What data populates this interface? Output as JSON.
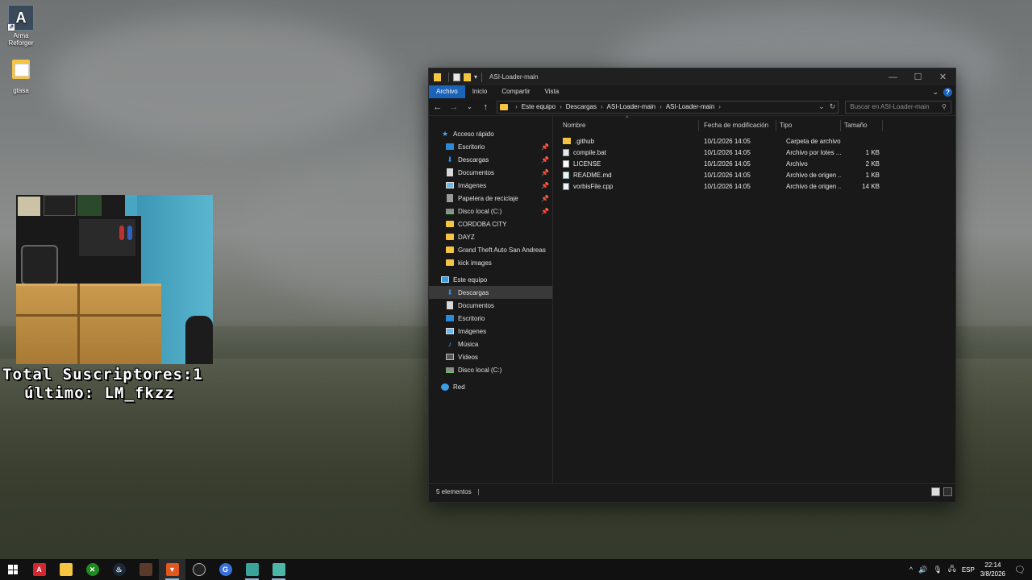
{
  "desktop": {
    "icons": [
      {
        "label_line1": "Arma",
        "label_line2": "Reforger"
      },
      {
        "label_line1": "gtasa",
        "label_line2": ""
      }
    ]
  },
  "overlay": {
    "subs_line": "Total Suscriptores:1",
    "last_line": "último: LM_fkzz"
  },
  "explorer": {
    "title": "ASI-Loader-main",
    "ribbon_tabs": [
      "Archivo",
      "Inicio",
      "Compartir",
      "Vista"
    ],
    "breadcrumb": [
      "Este equipo",
      "Descargas",
      "ASI-Loader-main",
      "ASI-Loader-main"
    ],
    "search_placeholder": "Buscar en ASI-Loader-main",
    "nav": {
      "quick_access": "Acceso rápido",
      "quick_items": [
        {
          "label": "Escritorio",
          "pinned": true
        },
        {
          "label": "Descargas",
          "pinned": true
        },
        {
          "label": "Documentos",
          "pinned": true
        },
        {
          "label": "Imágenes",
          "pinned": true
        },
        {
          "label": "Papelera de reciclaje",
          "pinned": true
        },
        {
          "label": "Disco local (C:)",
          "pinned": true
        },
        {
          "label": "CORDOBA CITY",
          "pinned": false
        },
        {
          "label": "DAYZ",
          "pinned": false
        },
        {
          "label": "Grand Theft Auto San Andreas",
          "pinned": false
        },
        {
          "label": "kick images",
          "pinned": false
        }
      ],
      "this_pc": "Este equipo",
      "pc_items": [
        "Descargas",
        "Documentos",
        "Escritorio",
        "Imágenes",
        "Música",
        "Vídeos",
        "Disco local (C:)"
      ],
      "network": "Red"
    },
    "columns": {
      "name": "Nombre",
      "date": "Fecha de modificación",
      "type": "Tipo",
      "size": "Tamaño"
    },
    "files": [
      {
        "name": ".github",
        "date": "10/1/2026 14:05",
        "type": "Carpeta de archivos",
        "size": ""
      },
      {
        "name": "compile.bat",
        "date": "10/1/2026 14:05",
        "type": "Archivo por lotes ...",
        "size": "1 KB"
      },
      {
        "name": "LICENSE",
        "date": "10/1/2026 14:05",
        "type": "Archivo",
        "size": "2 KB"
      },
      {
        "name": "README.md",
        "date": "10/1/2026 14:05",
        "type": "Archivo de origen ...",
        "size": "1 KB"
      },
      {
        "name": "vorbisFile.cpp",
        "date": "10/1/2026 14:05",
        "type": "Archivo de origen ...",
        "size": "14 KB"
      }
    ],
    "status": "5 elementos"
  },
  "taskbar": {
    "language": "ESP",
    "time": "22:14",
    "date": "3/8/2026"
  }
}
